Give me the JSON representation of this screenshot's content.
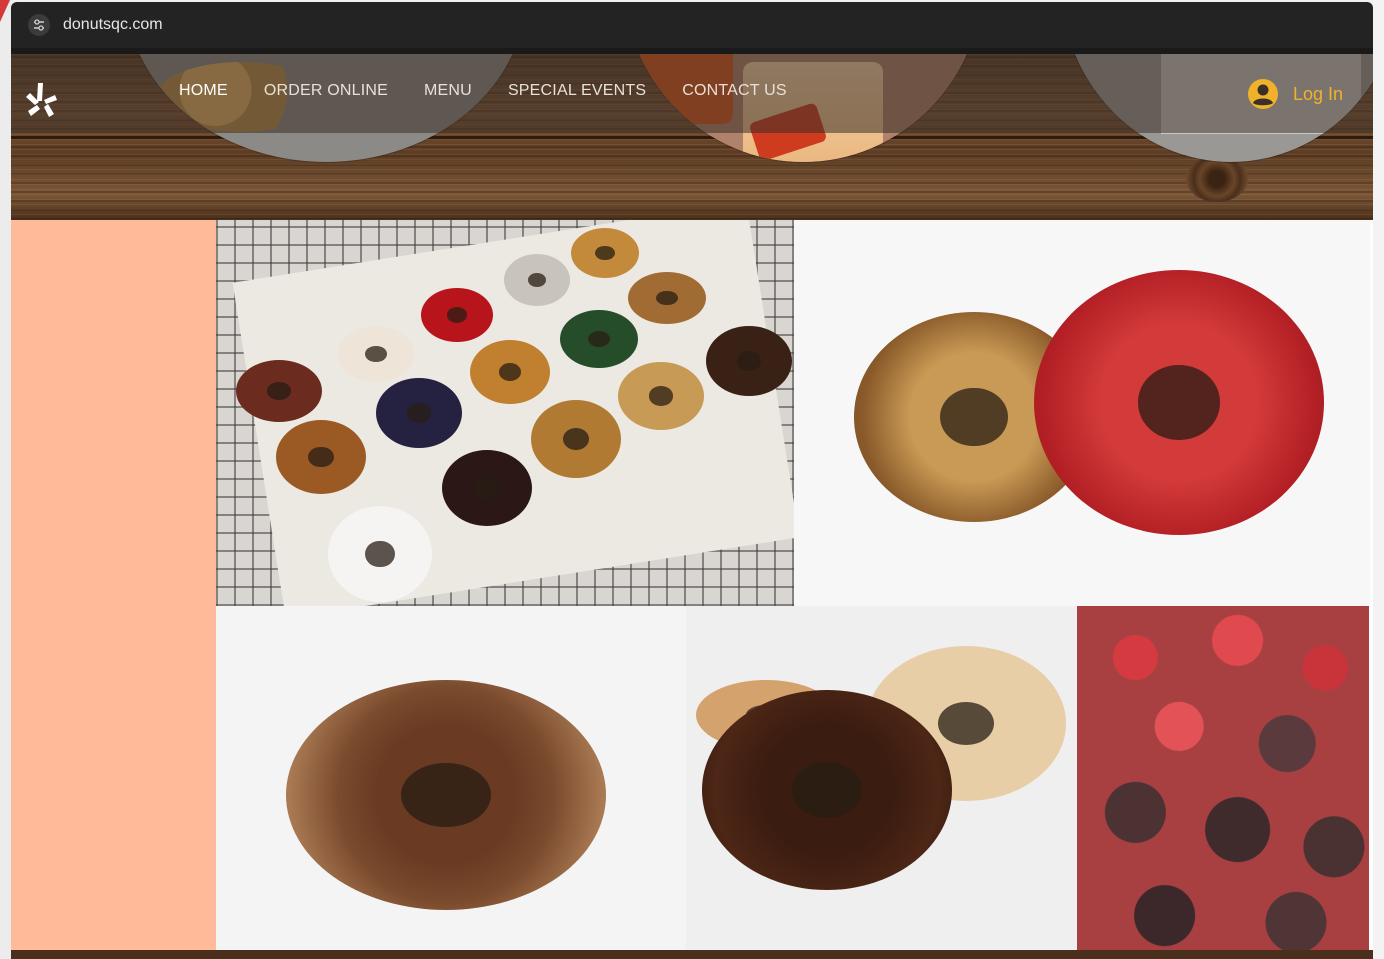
{
  "browser": {
    "url": "donutsqc.com"
  },
  "nav": {
    "items": [
      {
        "label": "HOME",
        "active": true
      },
      {
        "label": "ORDER ONLINE",
        "active": false
      },
      {
        "label": "MENU",
        "active": false
      },
      {
        "label": "SPECIAL EVENTS",
        "active": false
      },
      {
        "label": "CONTACT US",
        "active": false
      }
    ],
    "login_label": "Log In",
    "logo_icon": "yelp-burst-icon",
    "avatar_icon": "user-avatar-icon"
  },
  "colors": {
    "side_panel": "#ffbb99",
    "login_accent": "#f0b22b"
  },
  "gallery": {
    "images": [
      "tray-of-assorted-donuts-photo",
      "nut-topped-and-red-glazed-donuts-photo",
      "glazed-chocolate-old-fashioned-donut-photo",
      "chocolate-frosted-and-sugar-donuts-photo",
      "donut-holes-red-and-chocolate-photo"
    ]
  }
}
